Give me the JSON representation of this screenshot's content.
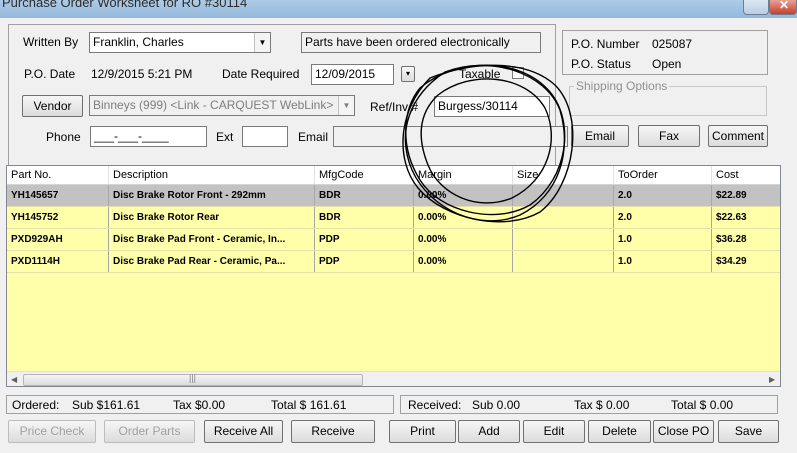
{
  "window": {
    "title": "Purchase Order Worksheet for RO #30114"
  },
  "header": {
    "written_by_label": "Written By",
    "written_by_value": "Franklin, Charles",
    "message": "Parts have been ordered electronically",
    "po_date_label": "P.O. Date",
    "po_date_value": "12/9/2015 5:21 PM",
    "date_required_label": "Date Required",
    "date_required_value": "12/09/2015",
    "taxable_label": "Taxable",
    "vendor_button": "Vendor",
    "vendor_value": "Binneys (999) <Link - CARQUEST WebLink>",
    "ref_label": "Ref/Inv #",
    "ref_value": "Burgess/30114",
    "phone_label": "Phone",
    "phone_value": "___-___-____",
    "ext_label": "Ext",
    "ext_value": "",
    "email_label": "Email",
    "email_value": ""
  },
  "status": {
    "po_number_label": "P.O. Number",
    "po_number_value": "025087",
    "po_status_label": "P.O. Status",
    "po_status_value": "Open"
  },
  "shipping": {
    "legend": "Shipping Options"
  },
  "contact_buttons": {
    "email": "Email",
    "fax": "Fax",
    "comment": "Comment"
  },
  "grid": {
    "columns": [
      "Part No.",
      "Description",
      "MfgCode",
      "Margin",
      "Size",
      "ToOrder",
      "Cost"
    ],
    "rows": [
      {
        "part_no": "YH145657",
        "description": "Disc Brake Rotor Front - 292mm",
        "mfg": "BDR",
        "margin": "0.00%",
        "size": "",
        "to_order": "2.0",
        "cost": "$22.89"
      },
      {
        "part_no": "YH145752",
        "description": "Disc Brake Rotor Rear",
        "mfg": "BDR",
        "margin": "0.00%",
        "size": "",
        "to_order": "2.0",
        "cost": "$22.63"
      },
      {
        "part_no": "PXD929AH",
        "description": "Disc Brake Pad Front - Ceramic, In...",
        "mfg": "PDP",
        "margin": "0.00%",
        "size": "",
        "to_order": "1.0",
        "cost": "$36.28"
      },
      {
        "part_no": "PXD1114H",
        "description": "Disc Brake Pad Rear - Ceramic, Pa...",
        "mfg": "PDP",
        "margin": "0.00%",
        "size": "",
        "to_order": "1.0",
        "cost": "$34.29"
      }
    ]
  },
  "totals": {
    "ordered_label": "Ordered:",
    "ordered_sub": "Sub  $161.61",
    "ordered_tax": "Tax  $0.00",
    "ordered_total": "Total $  161.61",
    "received_label": "Received:",
    "received_sub": "Sub   0.00",
    "received_tax": "Tax  $ 0.00",
    "received_total": "Total $  0.00"
  },
  "buttons": {
    "price_check": "Price Check",
    "order_parts": "Order Parts",
    "receive_all": "Receive All",
    "receive": "Receive",
    "print": "Print",
    "add": "Add",
    "edit": "Edit",
    "delete": "Delete",
    "close_po": "Close PO",
    "save": "Save"
  },
  "colors": {
    "grid_background": "#ffffaa",
    "selected_row": "#c2c2c2"
  }
}
